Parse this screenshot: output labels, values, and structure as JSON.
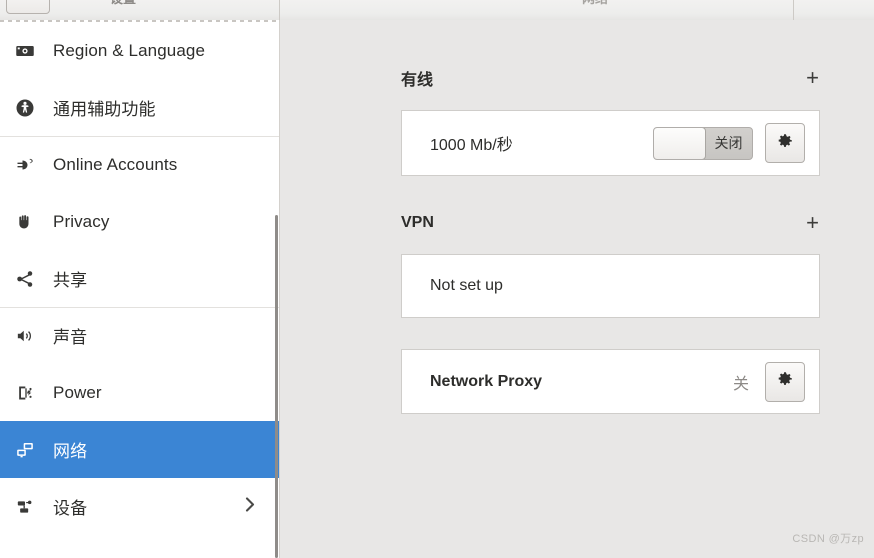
{
  "header": {
    "back_icon": "back-arrow-icon",
    "left_title": "设置",
    "right_title": "网络"
  },
  "sidebar": {
    "items": [
      {
        "id": "region-language",
        "label": "Region & Language",
        "icon": "flag-icon",
        "selected": false,
        "separator_above": false,
        "chevron": false
      },
      {
        "id": "universal-access",
        "label": "通用辅助功能",
        "icon": "accessibility-icon",
        "selected": false,
        "separator_above": false,
        "chevron": false
      },
      {
        "id": "online-accounts",
        "label": "Online Accounts",
        "icon": "online-accounts-icon",
        "selected": false,
        "separator_above": true,
        "chevron": false
      },
      {
        "id": "privacy",
        "label": "Privacy",
        "icon": "hand-privacy-icon",
        "selected": false,
        "separator_above": false,
        "chevron": false
      },
      {
        "id": "sharing",
        "label": "共享",
        "icon": "share-nodes-icon",
        "selected": false,
        "separator_above": false,
        "chevron": false
      },
      {
        "id": "sound",
        "label": "声音",
        "icon": "speaker-icon",
        "selected": false,
        "separator_above": true,
        "chevron": false
      },
      {
        "id": "power",
        "label": "Power",
        "icon": "battery-power-icon",
        "selected": false,
        "separator_above": false,
        "chevron": false
      },
      {
        "id": "network",
        "label": "网络",
        "icon": "network-screens-icon",
        "selected": true,
        "separator_above": false,
        "chevron": false
      },
      {
        "id": "devices",
        "label": "设备",
        "icon": "devices-printer-icon",
        "selected": false,
        "separator_above": false,
        "chevron": true
      }
    ],
    "selected_color": "#3b85d4"
  },
  "main": {
    "sections": [
      {
        "id": "wired",
        "title": "有线",
        "add_label": "+",
        "row": {
          "label": "1000 Mb/秒",
          "switch_state_label": "关闭",
          "switch_on": false,
          "gear_icon": "gear-icon"
        }
      },
      {
        "id": "vpn",
        "title": "VPN",
        "add_label": "+",
        "row": {
          "label": "Not set up"
        }
      }
    ],
    "proxy": {
      "label": "Network Proxy",
      "state_label": "关",
      "gear_icon": "gear-icon"
    }
  },
  "watermark": {
    "text": "CSDN @万zp"
  }
}
